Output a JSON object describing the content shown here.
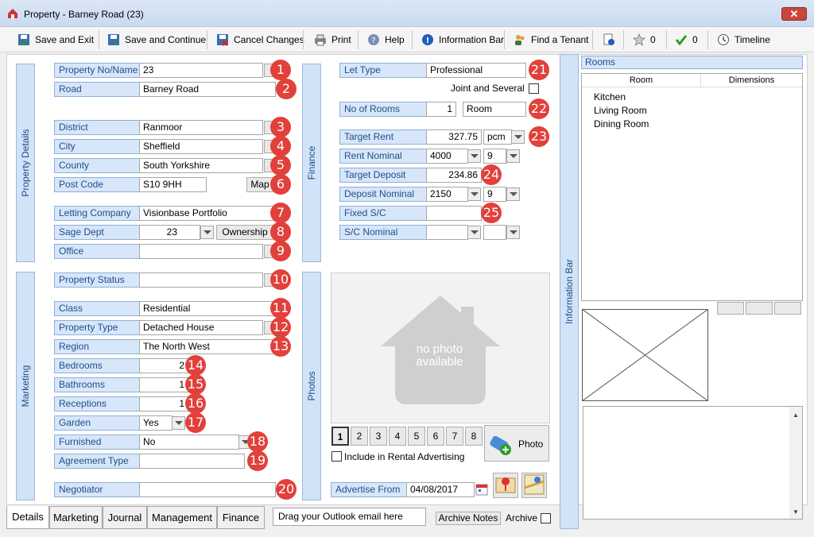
{
  "window": {
    "title": "Property  - Barney Road (23)",
    "close_label": "✕"
  },
  "toolbar": {
    "save_exit": "Save and Exit",
    "save_continue": "Save and Continue",
    "cancel": "Cancel Changes",
    "print": "Print",
    "help": "Help",
    "info_bar": "Information Bar",
    "find_tenant": "Find a Tenant",
    "star_count": "0",
    "check_count": "0",
    "timeline": "Timeline"
  },
  "side_tabs": {
    "property_details": "Property Details",
    "marketing": "Marketing",
    "finance": "Finance",
    "photos": "Photos",
    "information_bar": "Information Bar"
  },
  "fields": {
    "property_no": {
      "label": "Property No/Name",
      "value": "23",
      "badge": "1"
    },
    "road": {
      "label": "Road",
      "value": "Barney Road",
      "badge": "2"
    },
    "district": {
      "label": "District",
      "value": "Ranmoor",
      "badge": "3"
    },
    "city": {
      "label": "City",
      "value": "Sheffield",
      "badge": "4"
    },
    "county": {
      "label": "County",
      "value": "South Yorkshire",
      "badge": "5"
    },
    "post_code": {
      "label": "Post Code",
      "value": "S10 9HH",
      "map_button": "Map",
      "badge": "6"
    },
    "letting_company": {
      "label": "Letting Company",
      "value": "Visionbase Portfolio",
      "badge": "7"
    },
    "sage_dept": {
      "label": "Sage Dept",
      "value": "23",
      "ownership_button": "Ownership",
      "badge": "8"
    },
    "office": {
      "label": "Office",
      "value": "",
      "badge": "9"
    },
    "property_status": {
      "label": "Property Status",
      "value": "",
      "badge": "10"
    },
    "class": {
      "label": "Class",
      "value": "Residential",
      "badge": "11"
    },
    "property_type": {
      "label": "Property Type",
      "value": "Detached House",
      "badge": "12"
    },
    "region": {
      "label": "Region",
      "value": "The North West",
      "badge": "13"
    },
    "bedrooms": {
      "label": "Bedrooms",
      "value": "2",
      "badge": "14"
    },
    "bathrooms": {
      "label": "Bathrooms",
      "value": "1",
      "badge": "15"
    },
    "receptions": {
      "label": "Receptions",
      "value": "1",
      "badge": "16"
    },
    "garden": {
      "label": "Garden",
      "value": "Yes",
      "badge": "17"
    },
    "furnished": {
      "label": "Furnished",
      "value": "No",
      "badge": "18"
    },
    "agreement_type": {
      "label": "Agreement Type",
      "value": "",
      "badge": "19"
    },
    "negotiator": {
      "label": "Negotiator",
      "value": "",
      "badge": "20"
    }
  },
  "finance": {
    "let_type": {
      "label": "Let Type",
      "value": "Professional",
      "badge": "21"
    },
    "joint_several": "Joint and Several",
    "no_of_rooms": {
      "label": "No of Rooms",
      "value": "1",
      "unit": "Room",
      "badge": "22"
    },
    "target_rent": {
      "label": "Target Rent",
      "value": "327.75",
      "period": "pcm",
      "badge": "23"
    },
    "rent_nominal": {
      "label": "Rent Nominal",
      "value": "4000",
      "value2": "9"
    },
    "target_deposit": {
      "label": "Target Deposit",
      "value": "234.86",
      "badge": "24"
    },
    "deposit_nominal": {
      "label": "Deposit Nominal",
      "value": "2150",
      "value2": "9"
    },
    "fixed_sc": {
      "label": "Fixed S/C",
      "value": "",
      "badge": "25"
    },
    "sc_nominal": {
      "label": "S/C Nominal",
      "value": ""
    }
  },
  "photos": {
    "placeholder_text": "no photo available",
    "pages": [
      "1",
      "2",
      "3",
      "4",
      "5",
      "6",
      "7",
      "8"
    ],
    "photo_button": "Photo",
    "include_rental": "Include in  Rental Advertising",
    "advertise_from_label": "Advertise From",
    "advertise_from_value": "04/08/2017"
  },
  "rooms": {
    "header": "Rooms",
    "col_room": "Room",
    "col_dimensions": "Dimensions",
    "items": [
      "Kitchen",
      "Living Room",
      "Dining Room"
    ]
  },
  "bottom": {
    "tabs": [
      "Details",
      "Marketing",
      "Journal",
      "Management",
      "Finance"
    ],
    "drag_outlook": "Drag your Outlook email here",
    "archive_notes": "Archive Notes",
    "archive": "Archive"
  }
}
